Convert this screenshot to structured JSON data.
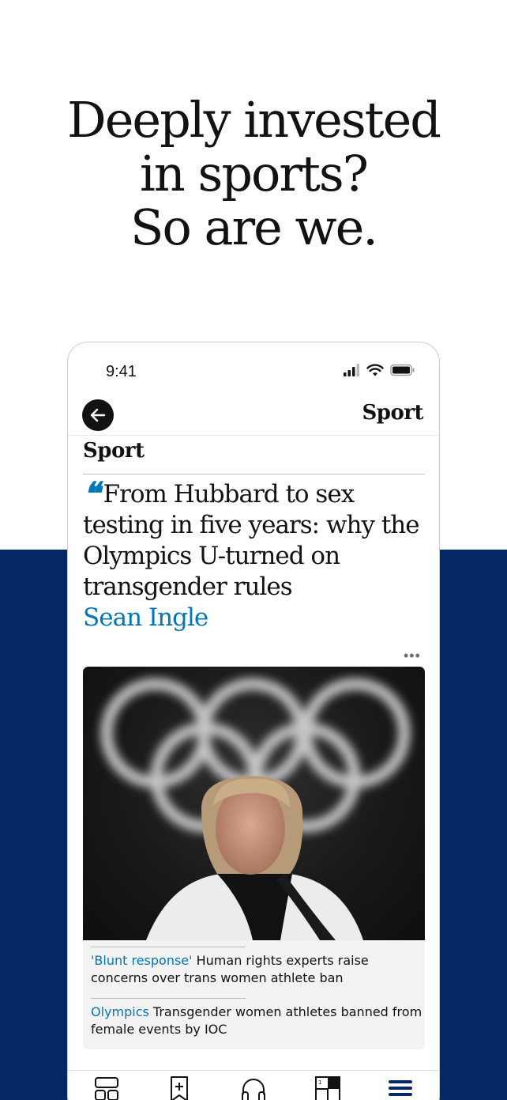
{
  "promo": {
    "headline_lines": [
      "Deeply invested",
      "in sports?",
      "So are we."
    ]
  },
  "status_bar": {
    "time": "9:41",
    "icons": [
      "signal-icon",
      "wifi-icon",
      "battery-icon"
    ]
  },
  "nav": {
    "back_icon": "arrow-left-icon",
    "title": "Sport"
  },
  "article": {
    "section": "Sport",
    "headline": "From Hubbard to sex testing in five years: why the Olympics U-turned on transgender rules",
    "byline": "Sean Ingle",
    "more_icon": "more-dots-icon",
    "image": "olympic-rings-photo",
    "related": [
      {
        "kicker": "'Blunt response'",
        "text": "Human rights experts raise concerns over trans women athlete ban"
      },
      {
        "kicker": "Olympics",
        "text": "Transgender women athletes banned from female events by IOC"
      }
    ]
  },
  "tab_bar": {
    "tabs": [
      "home-icon",
      "saved-icon",
      "headphones-icon",
      "crossword-icon",
      "menu-icon"
    ],
    "active": "menu-icon"
  },
  "colors": {
    "brand_blue": "#052962",
    "link_blue": "#0077b6"
  }
}
